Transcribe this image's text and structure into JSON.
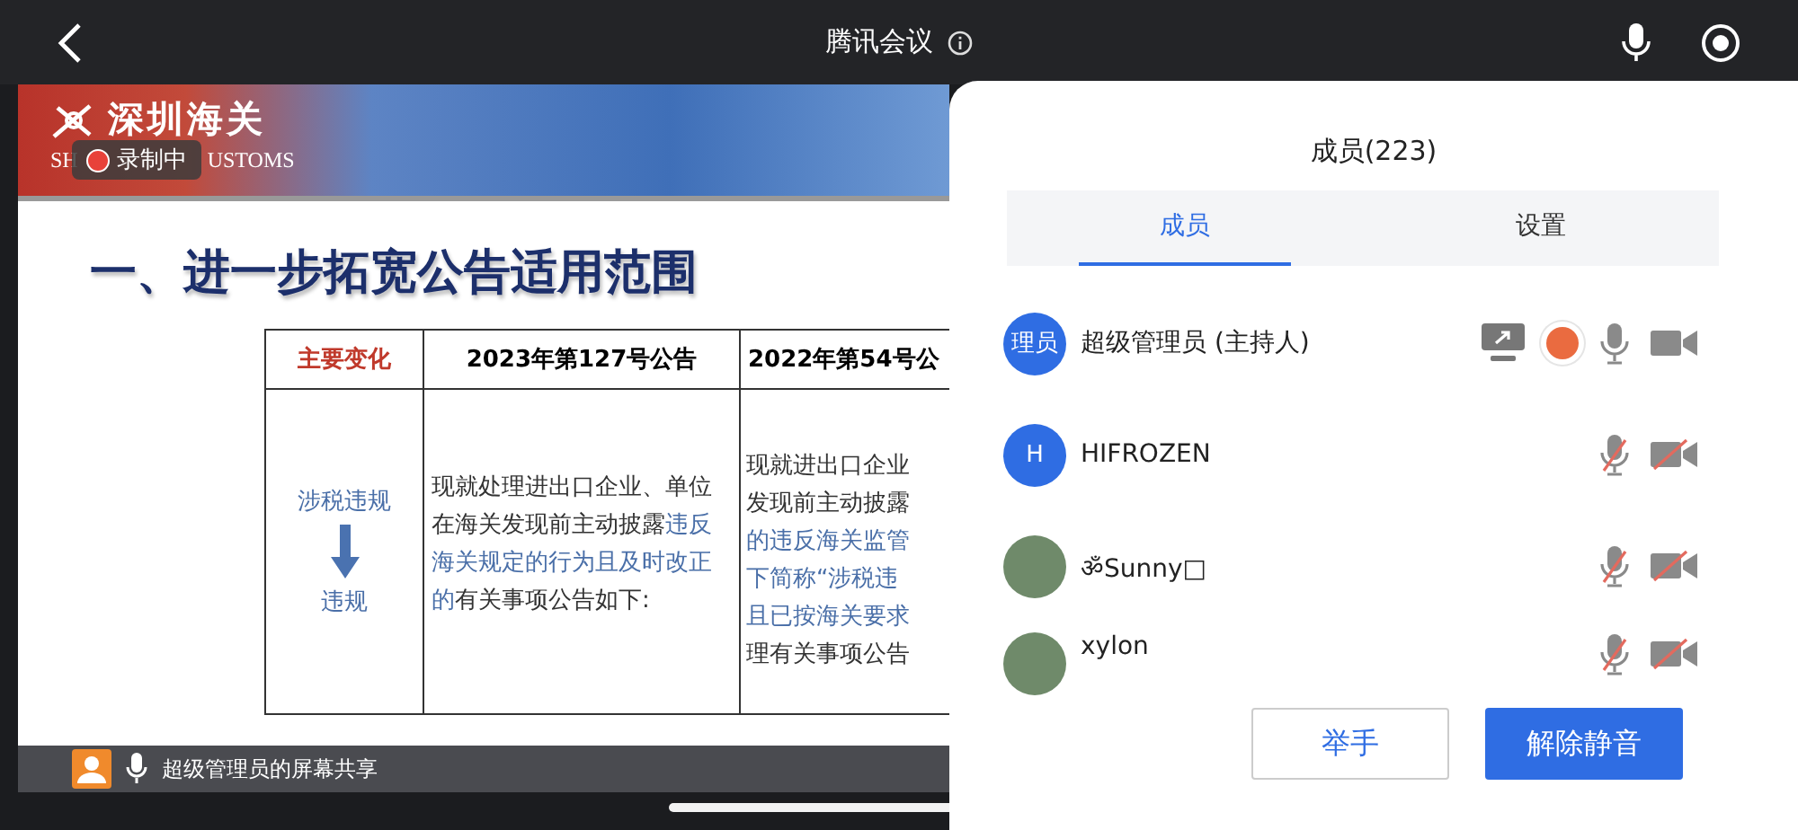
{
  "top_bar": {
    "title": "腾讯会议",
    "mic_on": true
  },
  "slide": {
    "logo_cn": "深圳海关",
    "logo_en_parts": [
      "SH",
      "USTOMS"
    ],
    "recording_badge": {
      "label": "录制中",
      "recording": true
    },
    "title": "一、进一步拓宽公告适用范围",
    "table": {
      "columns": [
        "主要变化",
        "2023年第127号公告",
        "2022年第54号公"
      ],
      "change_from": "涉税违规",
      "change_to": "违规",
      "cell_2": [
        {
          "text": "现就处理进出口企业、单位在海关发现前主动披露",
          "emphasis": false
        },
        {
          "text": "违反海关规定的行为且及时改正的",
          "emphasis": true
        },
        {
          "text": "有关事项公告如下:",
          "emphasis": false
        }
      ],
      "cell_3_lines": [
        {
          "text": "现就进出口企业",
          "emphasis": false
        },
        {
          "text": "发现前主动披露",
          "emphasis": false
        },
        {
          "text": "的违反海关监管",
          "emphasis": true
        },
        {
          "text": "下简称“涉税违",
          "emphasis": true
        },
        {
          "text": "且已按海关要求",
          "emphasis": true
        },
        {
          "text": "理有关事项公告",
          "emphasis": false
        }
      ]
    }
  },
  "share_bar": {
    "label": "超级管理员的屏幕共享"
  },
  "panel": {
    "title": "成员(223)",
    "tabs": [
      {
        "label": "成员",
        "selected": true
      },
      {
        "label": "设置",
        "selected": false
      }
    ],
    "members": [
      {
        "name": "超级管理员 (主持人)",
        "kind": "initials",
        "avatar_text": "理员",
        "sharing": true,
        "recording": true,
        "mic_on": true,
        "camera_on": true
      },
      {
        "name": "HIFROZEN",
        "kind": "initials",
        "avatar_text": "H",
        "sharing": false,
        "recording": false,
        "mic_on": false,
        "camera_on": false
      },
      {
        "name": "ॐSunny□",
        "kind": "photo",
        "sharing": false,
        "recording": false,
        "mic_on": false,
        "camera_on": false
      },
      {
        "name": "xylon",
        "kind": "photo",
        "sharing": false,
        "recording": false,
        "mic_on": false,
        "camera_on": false
      }
    ],
    "buttons": [
      {
        "label": "举手",
        "kind": "secondary"
      },
      {
        "label": "解除静音",
        "kind": "primary"
      }
    ]
  }
}
